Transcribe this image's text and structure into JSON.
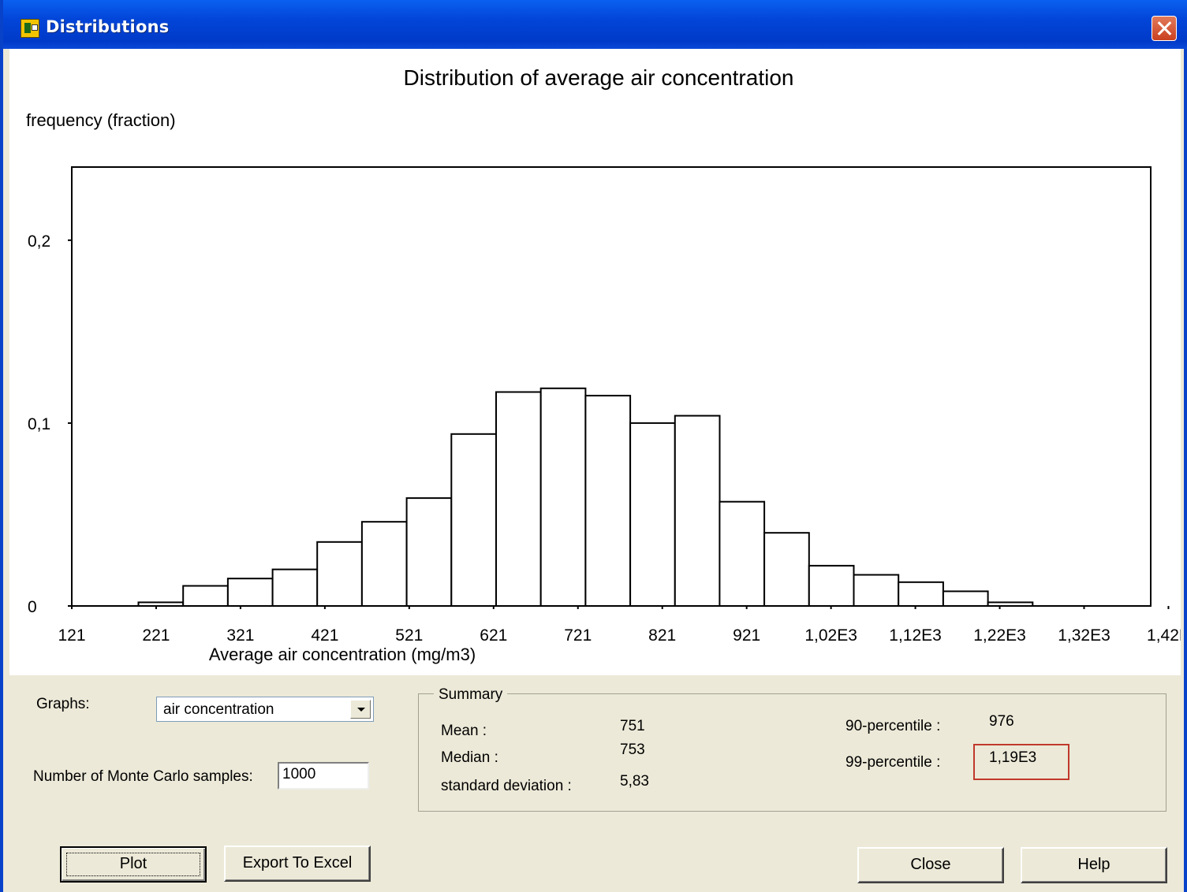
{
  "window": {
    "title": "Distributions"
  },
  "chart_data": {
    "type": "bar",
    "title": "Distribution of average air concentration",
    "ylabel": "frequency (fraction)",
    "xlabel": "Average air concentration (mg/m3)",
    "x_ticks": [
      "121",
      "221",
      "321",
      "421",
      "521",
      "621",
      "721",
      "821",
      "921",
      "1,02E3",
      "1,12E3",
      "1,22E3",
      "1,32E3",
      "1,42E"
    ],
    "y_ticks": [
      "0",
      "0,1",
      "0,2"
    ],
    "ylim": [
      0,
      0.24
    ],
    "xlim": [
      121,
      1400
    ],
    "bin_width": 53,
    "bin_starts": [
      200,
      253,
      306,
      359,
      412,
      465,
      518,
      571,
      624,
      677,
      730,
      783,
      836,
      889,
      942,
      995,
      1048,
      1101,
      1154
    ],
    "values": [
      0.002,
      0.011,
      0.015,
      0.02,
      0.035,
      0.046,
      0.059,
      0.094,
      0.117,
      0.119,
      0.115,
      0.1,
      0.104,
      0.057,
      0.04,
      0.022,
      0.017,
      0.013,
      0.008,
      0.002
    ]
  },
  "controls": {
    "graphs_label": "Graphs:",
    "graphs_selected": "air concentration",
    "mc_label": "Number of Monte Carlo samples:",
    "mc_value": "1000"
  },
  "summary": {
    "legend": "Summary",
    "mean_label": "Mean :",
    "mean_value": "751",
    "median_label": "Median :",
    "median_value": "753",
    "sd_label": "standard deviation :",
    "sd_value": "5,83",
    "p90_label": "90-percentile :",
    "p90_value": "976",
    "p99_label": "99-percentile :",
    "p99_value": "1,19E3"
  },
  "buttons": {
    "plot": "Plot",
    "export": "Export To Excel",
    "close": "Close",
    "help": "Help"
  },
  "colors": {
    "title_bar": "#0245d8",
    "highlight": "#c0392b",
    "dialog_bg": "#ece9d8"
  }
}
